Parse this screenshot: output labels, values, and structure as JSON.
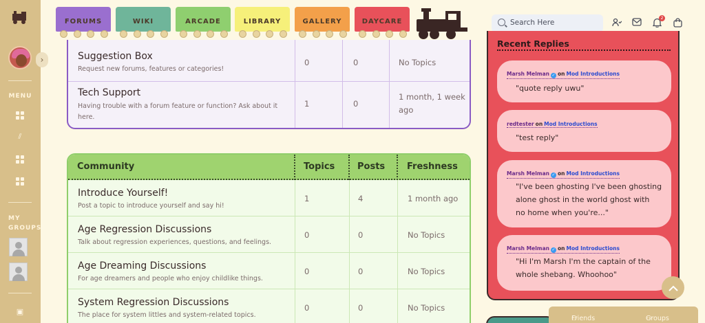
{
  "nav": {
    "cars": [
      {
        "label": "FORUMS",
        "color": "#9a6fcf"
      },
      {
        "label": "WIKI",
        "color": "#6fb59a"
      },
      {
        "label": "ARCADE",
        "color": "#8fcf6f"
      },
      {
        "label": "LIBRARY",
        "color": "#f6f07a"
      },
      {
        "label": "GALLERY",
        "color": "#f3a04a"
      },
      {
        "label": "DAYCARE",
        "color": "#e8515a"
      }
    ]
  },
  "sidebar": {
    "menu_label": "MENU",
    "groups_label_1": "MY",
    "groups_label_2": "GROUPS"
  },
  "header": {
    "search_placeholder": "Search Here",
    "notification_count": "2"
  },
  "top_forums": [
    {
      "title": "Suggestion Box",
      "desc": "Request new forums, features or categories!",
      "topics": "0",
      "posts": "0",
      "freshness": "No Topics"
    },
    {
      "title": "Tech Support",
      "desc_1": "Having trouble with a forum feature or function? Ask about it",
      "desc_2": "here.",
      "topics": "1",
      "posts": "0",
      "fresh_1": "1 month, 1 week",
      "fresh_2": "ago"
    }
  ],
  "community": {
    "head": {
      "title": "Community",
      "topics": "Topics",
      "posts": "Posts",
      "freshness": "Freshness"
    },
    "rows": [
      {
        "title": "Introduce Yourself!",
        "desc": "Post a topic to introduce yourself and say hi!",
        "topics": "1",
        "posts": "4",
        "freshness": "1 month ago"
      },
      {
        "title": "Age Regression Discussions",
        "desc": "Talk about regression experiences, questions, and feelings.",
        "topics": "0",
        "posts": "0",
        "freshness": "No Topics"
      },
      {
        "title": "Age Dreaming Discussions",
        "desc": "For age dreamers and people who enjoy childlike things.",
        "topics": "0",
        "posts": "0",
        "freshness": "No Topics"
      },
      {
        "title": "System Regression Discussions",
        "desc": "The place for system littles and system-related topics.",
        "topics": "0",
        "posts": "0",
        "freshness": "No Topics"
      }
    ]
  },
  "recent_replies": {
    "title": "Recent Replies",
    "on": "on",
    "items": [
      {
        "author": "Marsh Melman",
        "verified": true,
        "topic": "Mod Introductions",
        "line1": "\"quote reply uwu\""
      },
      {
        "author": "redtester",
        "verified": false,
        "topic": "Mod Introductions",
        "line1": "\"test reply\""
      },
      {
        "author": "Marsh Melman",
        "verified": true,
        "topic": "Mod Introductions",
        "line1": "\"I've been ghosting I've been ghosting",
        "line2": "alone ghost in the world ghost with",
        "line3": "no home when you're...\""
      },
      {
        "author": "Marsh Melman",
        "verified": true,
        "topic": "Mod Introductions",
        "line1": "\"Hi I'm Marsh I'm the captain of the",
        "line2": "whole shebang. Whoohoo\""
      }
    ]
  },
  "bottom_bar": {
    "friends": "Friends",
    "groups": "Groups"
  }
}
